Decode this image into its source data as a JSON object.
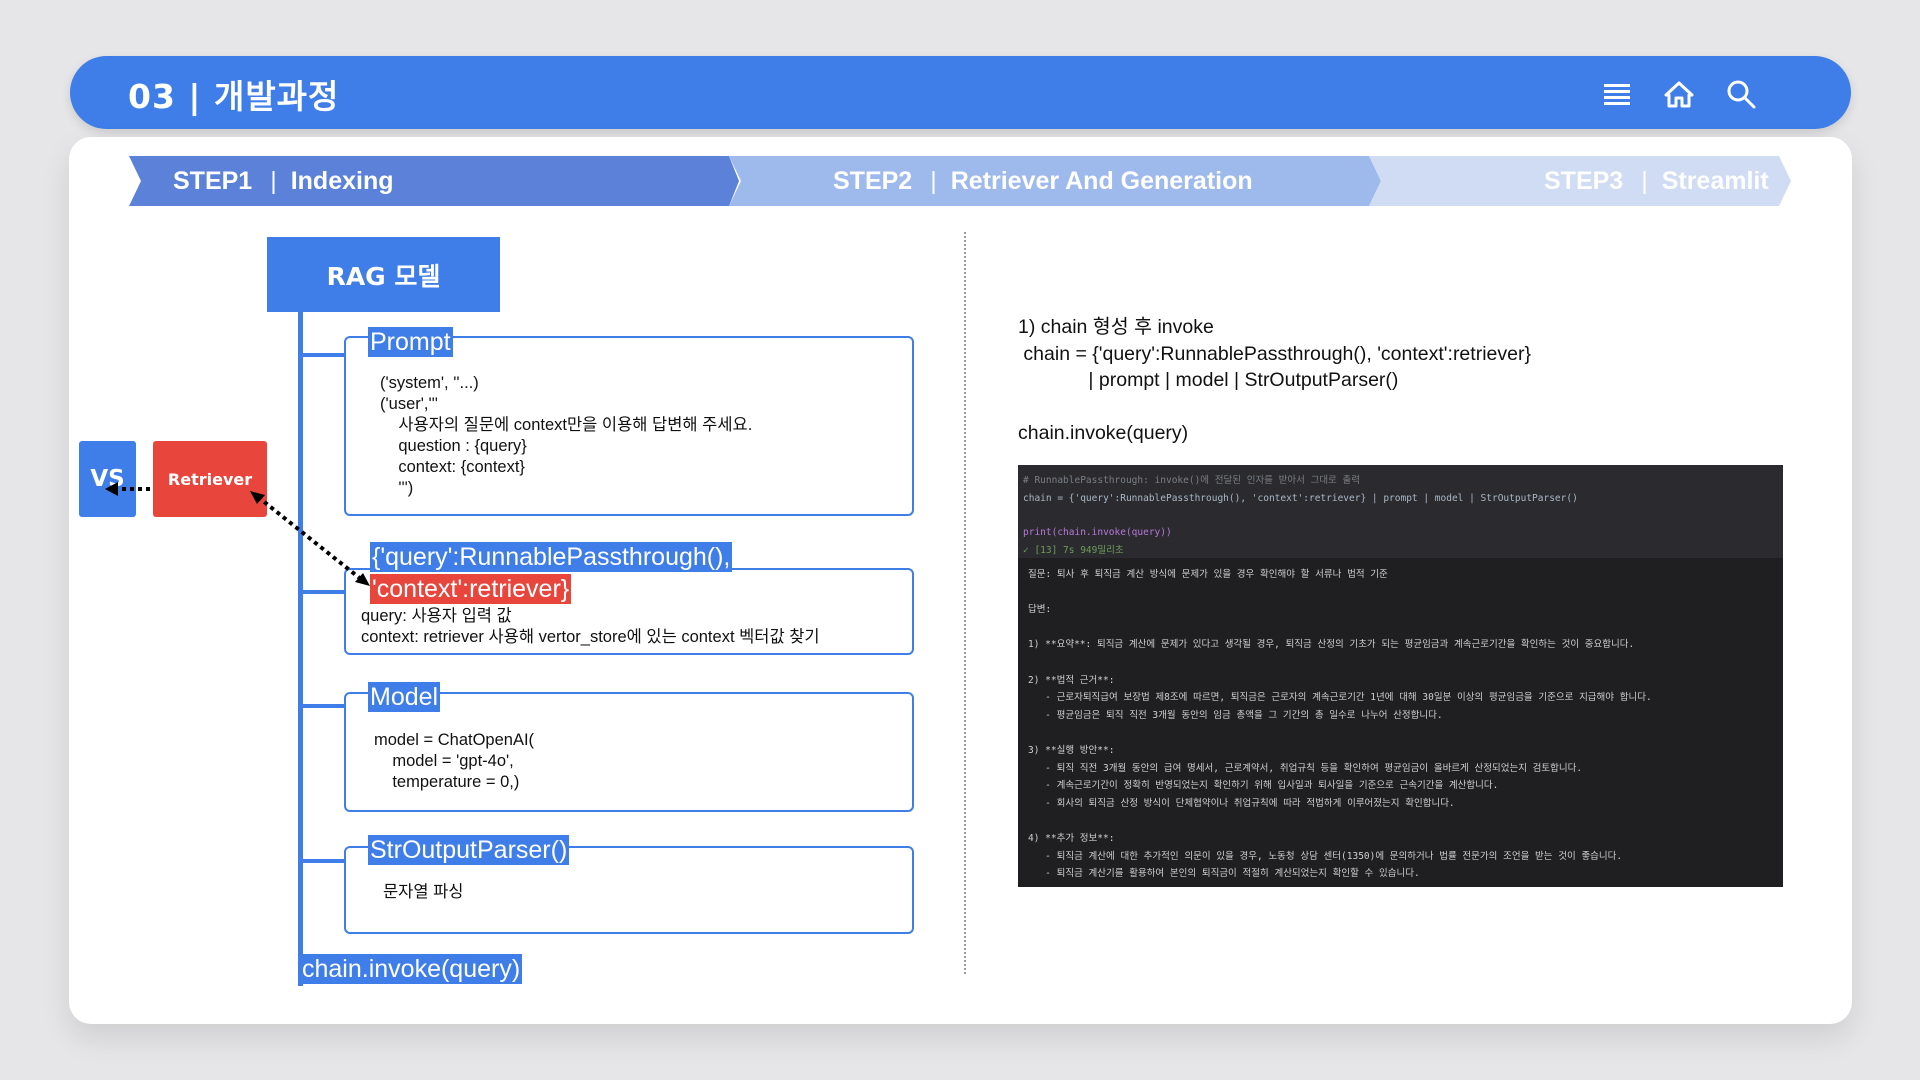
{
  "header": {
    "title": "03 | 개발과정",
    "icons": [
      "menu-icon",
      "home-icon",
      "search-icon"
    ]
  },
  "steps": [
    {
      "label": "STEP1",
      "name": "Indexing"
    },
    {
      "label": "STEP2",
      "name": "Retriever And Generation"
    },
    {
      "label": "STEP3",
      "name": "Streamlit"
    }
  ],
  "left": {
    "rag_title": "RAG 모델",
    "vs_label": "VS",
    "retriever_label": "Retriever",
    "prompt": {
      "tag": "Prompt",
      "lines": [
        "('system', ''...)",
        "('user','''",
        "    사용자의 질문에 context만을 이용해 답변해 주세요.",
        "    question : {query}",
        "    context: {context}",
        "    ''')"
      ]
    },
    "passthrough": {
      "tag_query": "{'query':RunnablePassthrough(),",
      "tag_context": "'context':retriever}",
      "line1": "query: 사용자 입력 값",
      "line2": "context: retriever 사용해 vertor_store에 있는 context 벡터값 찾기"
    },
    "model": {
      "tag": "Model",
      "lines": [
        "model = ChatOpenAI(",
        "    model = 'gpt-4o',",
        "    temperature = 0,)"
      ]
    },
    "parser": {
      "tag": "StrOutputParser()",
      "line": "문자열 파싱"
    },
    "invoke_tag": "chain.invoke(query)"
  },
  "right": {
    "line1": "1) chain 형성 후 invoke",
    "line2": " chain = {'query':RunnablePassthrough(), 'context':retriever}",
    "line3": "             | prompt | model | StrOutputParser()",
    "line4": "chain.invoke(query)",
    "code": {
      "comment": "# RunnablePassthrough: invoke()에 전달된 인자를 받아서 그대로 출력",
      "chain_line": "chain = {'query':RunnablePassthrough(), 'context':retriever} | prompt | model | StrOutputParser()",
      "print_line": "print(chain.invoke(query))",
      "status": "✓ [13] 7s 949밀리초",
      "output": [
        "질문: 퇴사 후 퇴직금 계산 방식에 문제가 있을 경우 확인해야 할 서류나 법적 기준",
        "",
        "답변:",
        "",
        "1) **요약**: 퇴직금 계산에 문제가 있다고 생각될 경우, 퇴직금 산정의 기초가 되는 평균임금과 계속근로기간을 확인하는 것이 중요합니다.",
        "",
        "2) **법적 근거**:",
        "   - 근로자퇴직급여 보장법 제8조에 따르면, 퇴직금은 근로자의 계속근로기간 1년에 대해 30일분 이상의 평균임금을 기준으로 지급해야 합니다.",
        "   - 평균임금은 퇴직 직전 3개월 동안의 임금 총액을 그 기간의 총 일수로 나누어 산정합니다.",
        "",
        "3) **실행 방안**:",
        "   - 퇴직 직전 3개월 동안의 급여 명세서, 근로계약서, 취업규칙 등을 확인하여 평균임금이 올바르게 산정되었는지 검토합니다.",
        "   - 계속근로기간이 정확히 반영되었는지 확인하기 위해 입사일과 퇴사일을 기준으로 근속기간을 계산합니다.",
        "   - 회사의 퇴직금 산정 방식이 단체협약이나 취업규칙에 따라 적법하게 이루어졌는지 확인합니다.",
        "",
        "4) **추가 정보**:",
        "   - 퇴직금 계산에 대한 추가적인 의문이 있을 경우, 노동청 상담 센터(1350)에 문의하거나 법률 전문가의 조언을 받는 것이 좋습니다.",
        "   - 퇴직금 계산기를 활용하여 본인의 퇴직금이 적절히 계산되었는지 확인할 수 있습니다."
      ]
    }
  },
  "colors": {
    "accent": "#3f7ee8",
    "red": "#e8453c",
    "step1": "#5b82d8",
    "step2": "#9eb9ec",
    "step3": "#d0dcf3"
  }
}
